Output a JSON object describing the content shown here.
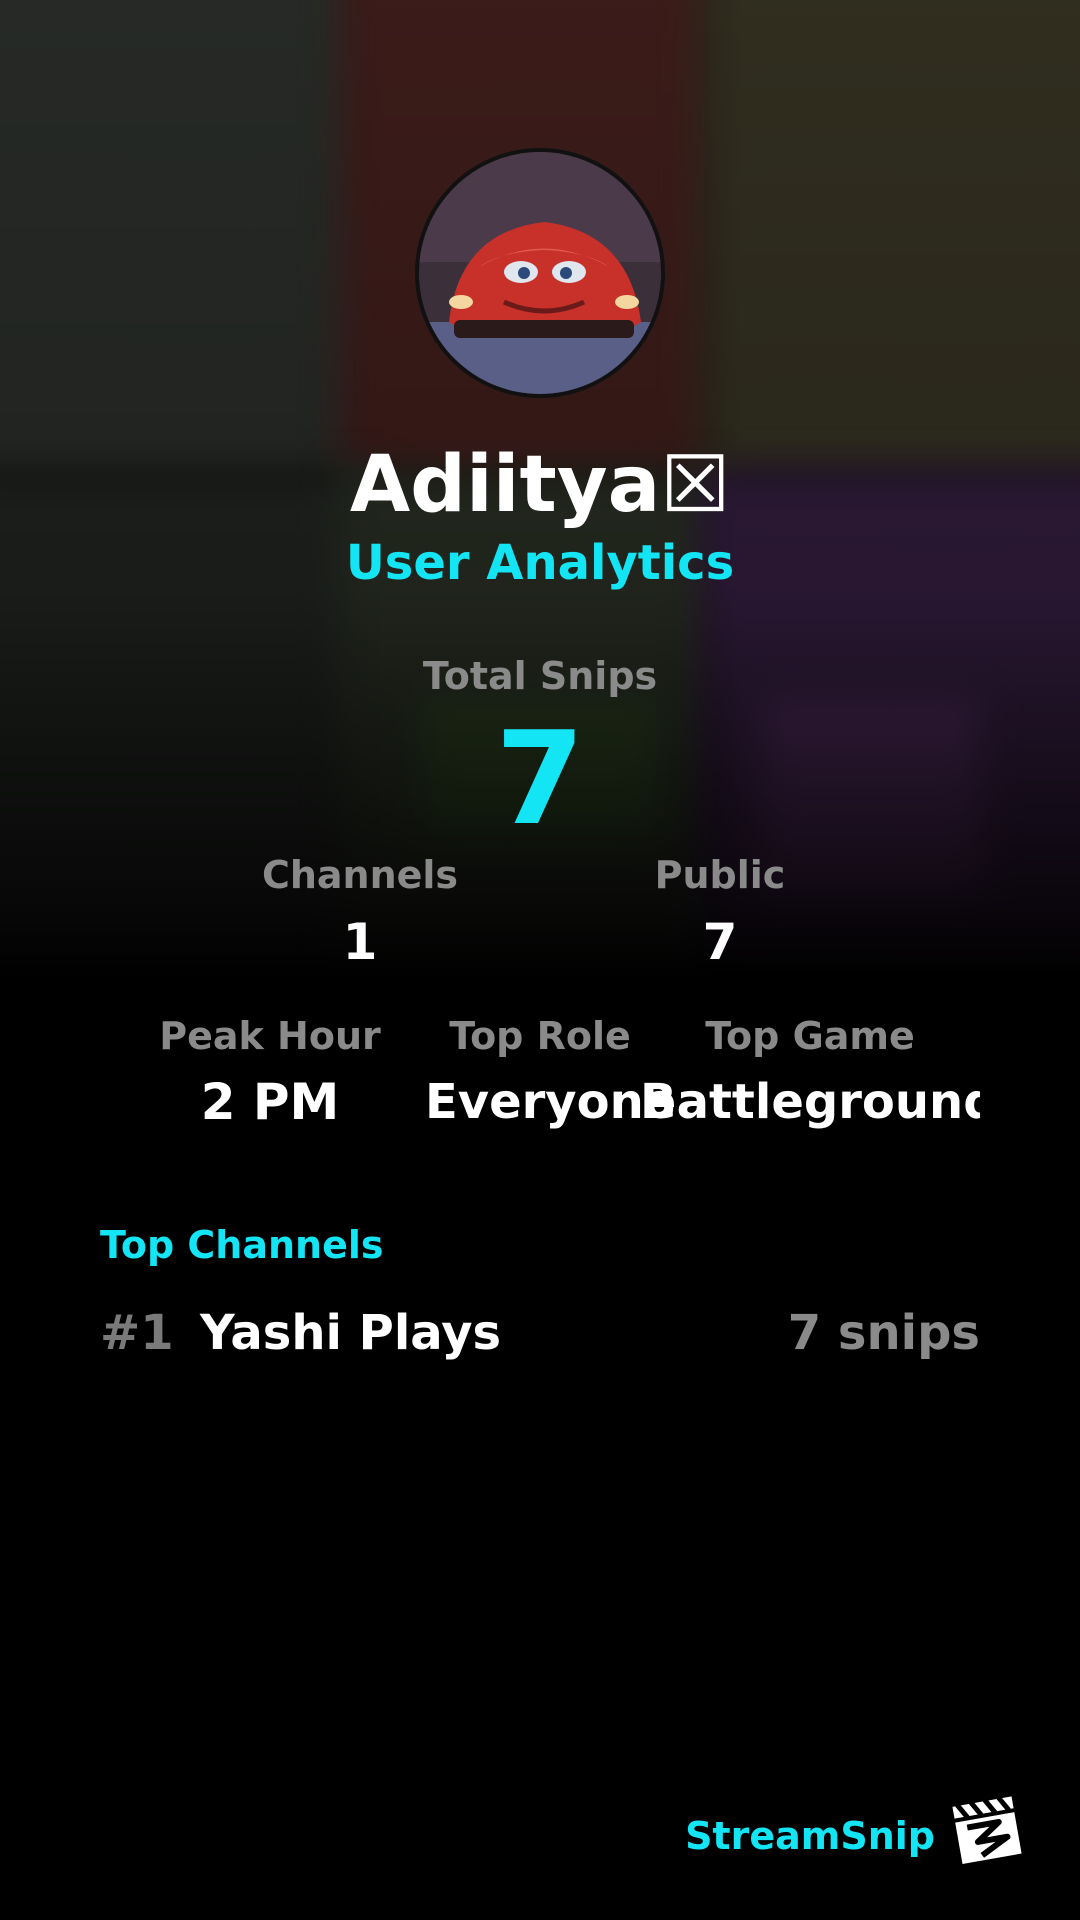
{
  "profile": {
    "username": "Adiitya☒",
    "subtitle": "User Analytics"
  },
  "stats": {
    "total_snips_label": "Total Snips",
    "total_snips_value": "7",
    "channels_label": "Channels",
    "channels_value": "1",
    "public_label": "Public",
    "public_value": "7",
    "peak_hour_label": "Peak Hour",
    "peak_hour_value": "2 PM",
    "top_role_label": "Top Role",
    "top_role_value": "Everyone",
    "top_game_label": "Top Game",
    "top_game_value": "Battleground.."
  },
  "top_channels": {
    "title": "Top Channels",
    "items": [
      {
        "rank": "#1",
        "name": "Yashi Plays",
        "count": "7 snips"
      }
    ]
  },
  "brand": {
    "name": "StreamSnip",
    "logo_icon": "clapperboard-icon"
  },
  "colors": {
    "accent": "#14e5f5",
    "muted": "#8a8a8a",
    "background": "#000000"
  }
}
